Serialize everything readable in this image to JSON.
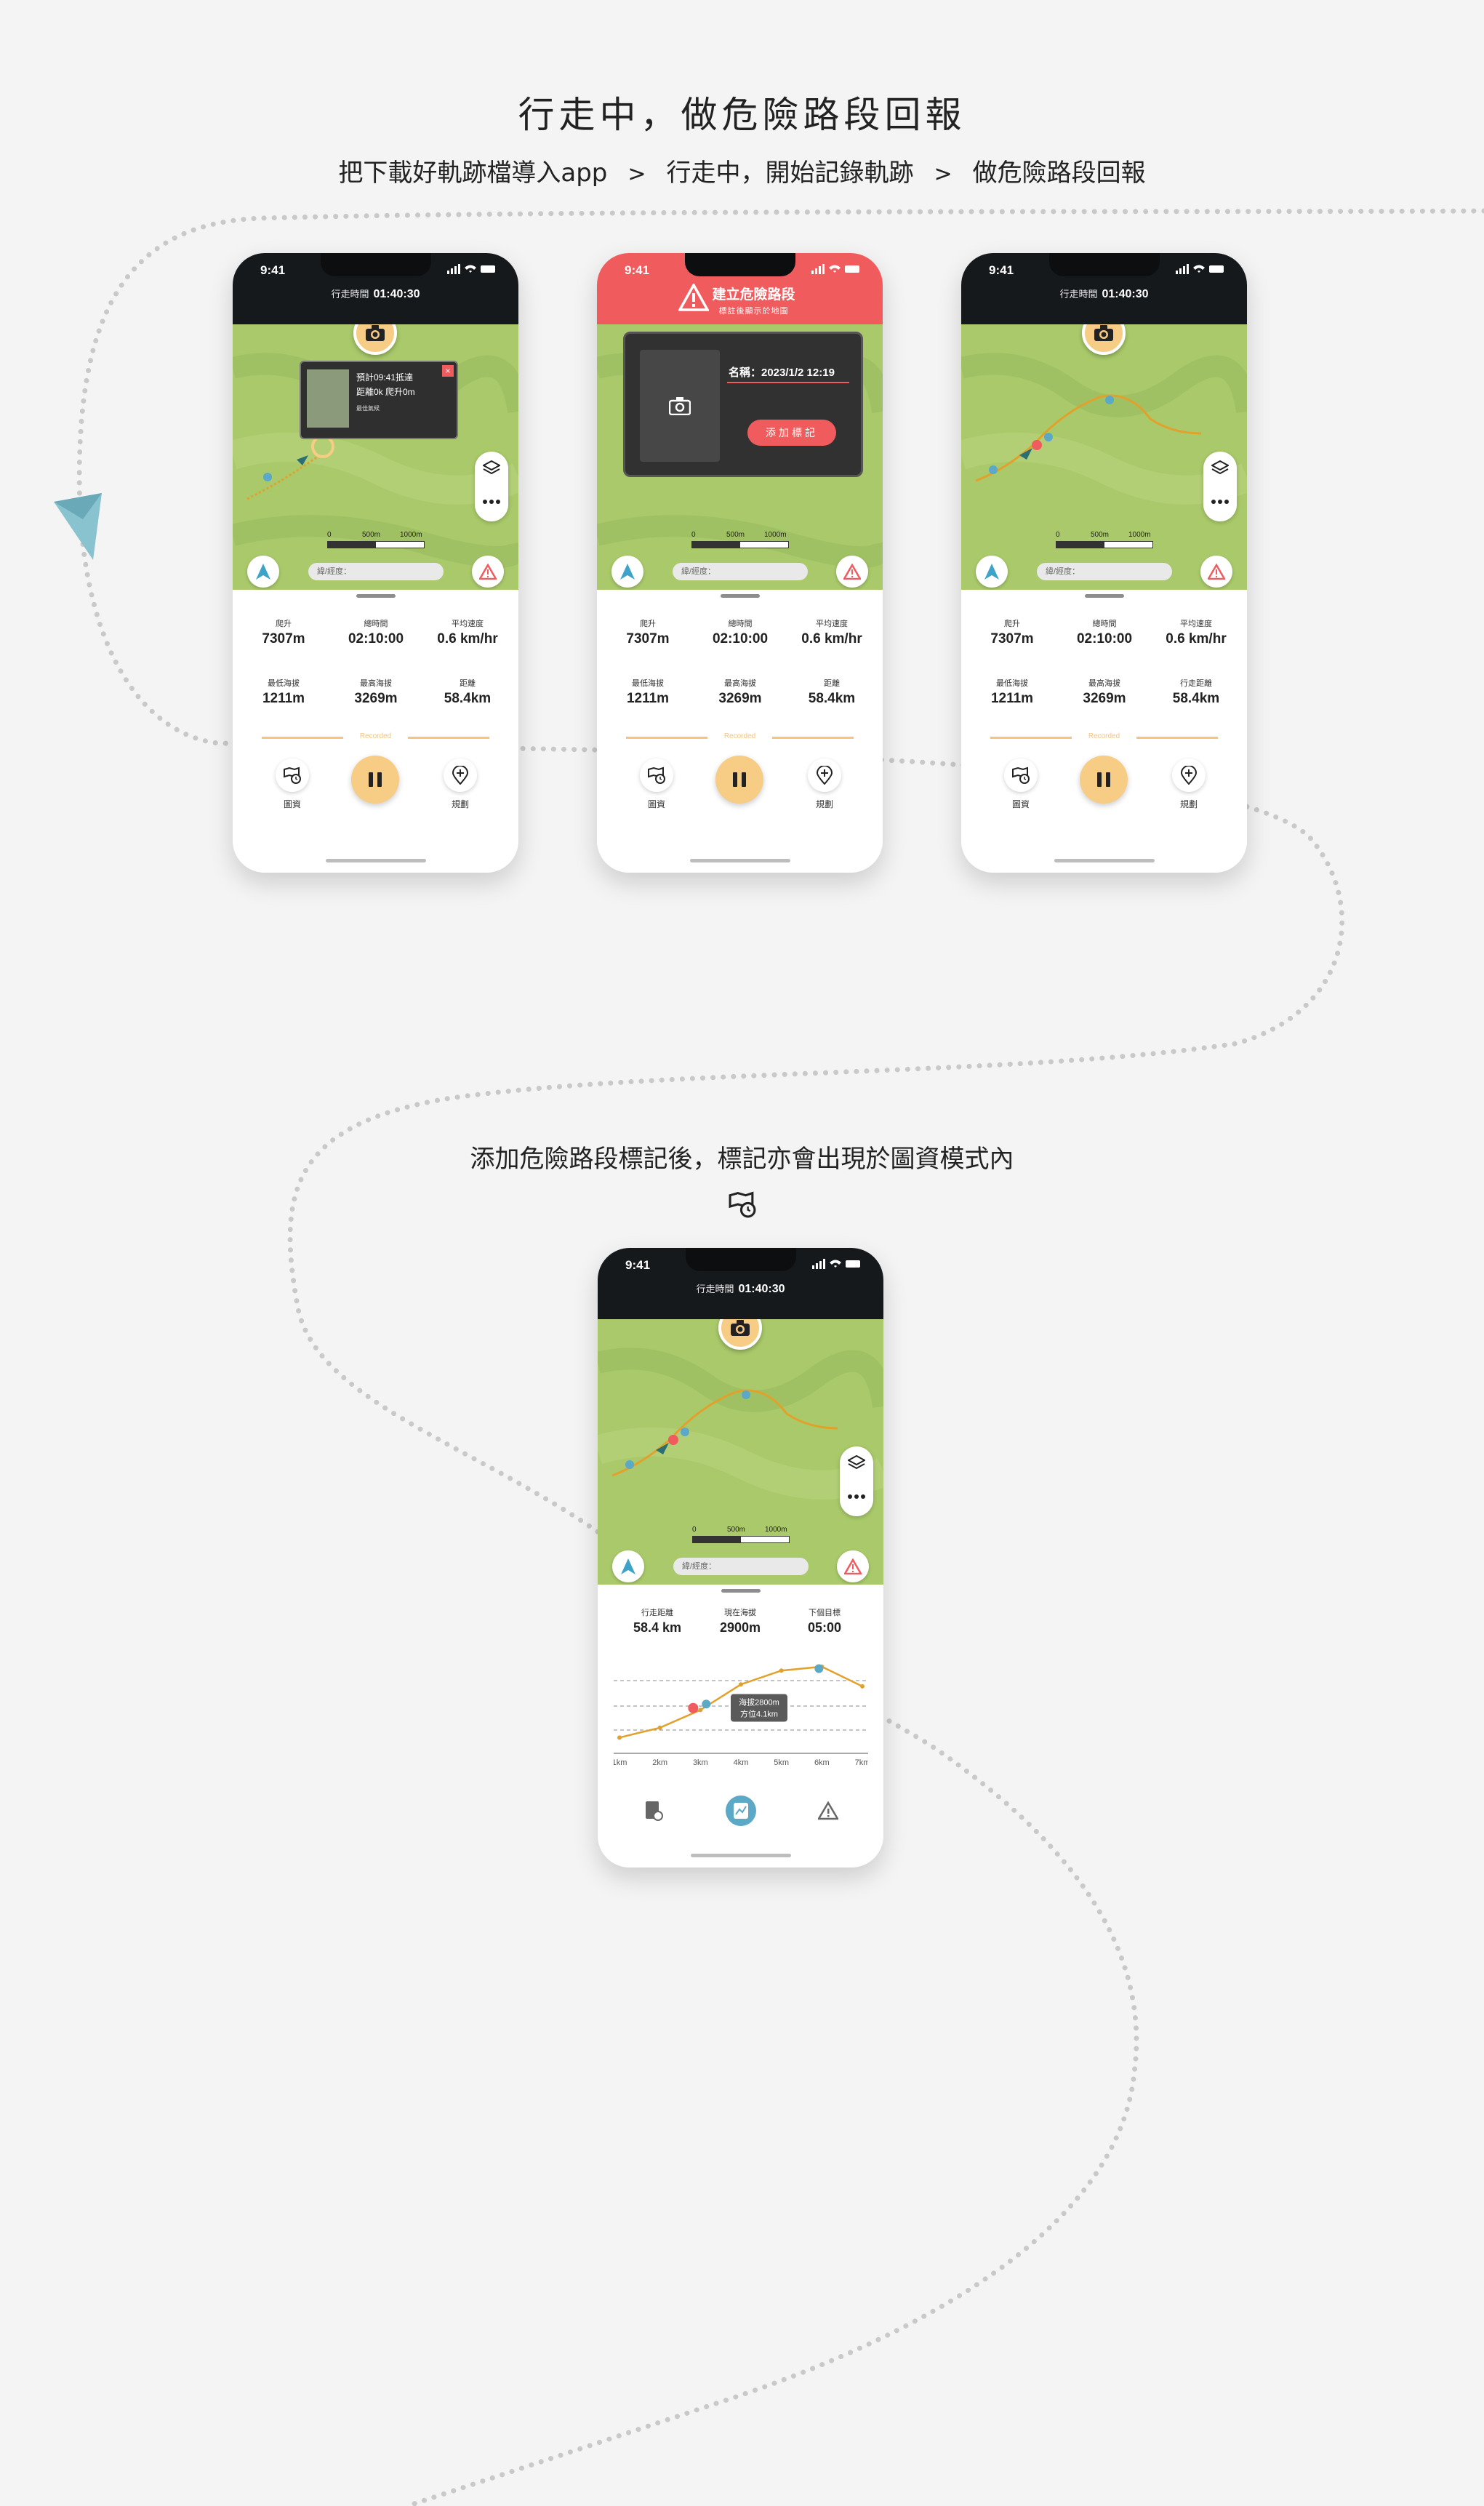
{
  "header": {
    "title": "行走中，做危險路段回報",
    "steps": [
      "把下載好軌跡檔導入app",
      "行走中，開始記錄軌跡",
      "做危險路段回報"
    ],
    "separator": ">"
  },
  "section2": {
    "caption": "添加危險路段標記後，標記亦會出現於圖資模式內"
  },
  "status_bar": {
    "time": "9:41"
  },
  "walk_time": {
    "label": "行走時間",
    "value": "01:40:30"
  },
  "map": {
    "coord_placeholder": "緯/經度：",
    "scale_labels": [
      "0",
      "500m",
      "1000m"
    ]
  },
  "stats": [
    {
      "label": "爬升",
      "value": "7307m"
    },
    {
      "label": "總時間",
      "value": "02:10:00"
    },
    {
      "label": "平均速度",
      "value": "0.6 km/hr"
    },
    {
      "label": "最低海拔",
      "value": "1211m"
    },
    {
      "label": "最高海拔",
      "value": "3269m"
    },
    {
      "label": "距離",
      "value": "58.4km"
    }
  ],
  "stats_phone3_distance_label": "行走距離",
  "recorded_label": "Recorded",
  "actions": {
    "map_info": "圖資",
    "plan": "規劃"
  },
  "info_card": {
    "line1": "預計09:41抵達",
    "line2": "距離0k  爬升0m",
    "line3": "最佳氣候",
    "close": "×"
  },
  "danger": {
    "title": "建立危險路段",
    "subtitle": "標註後顯示於地圖",
    "name": "名稱：2023/1/2 12:19",
    "add_button": "添加標記"
  },
  "elevation": {
    "stats": [
      {
        "label": "行走距離",
        "value": "58.4 km"
      },
      {
        "label": "現在海拔",
        "value": "2900m"
      },
      {
        "label": "下個目標",
        "value": "05:00"
      }
    ],
    "tooltip_line1": "海拔2800m",
    "tooltip_line2": "方位4.1km"
  },
  "chart_data": {
    "type": "line",
    "title": "",
    "xlabel": "",
    "ylabel": "",
    "categories": [
      "1km",
      "2km",
      "3km",
      "4km",
      "5km",
      "6km",
      "7km"
    ],
    "series": [
      {
        "values": [
          1400,
          1650,
          2100,
          2750,
          3100,
          3200,
          2700
        ]
      }
    ]
  },
  "colors": {
    "accent": "#f7cc84",
    "danger": "#f05b5e",
    "route": "#e2a12c",
    "topbar": "#16191c",
    "map": "#a9c96a"
  }
}
